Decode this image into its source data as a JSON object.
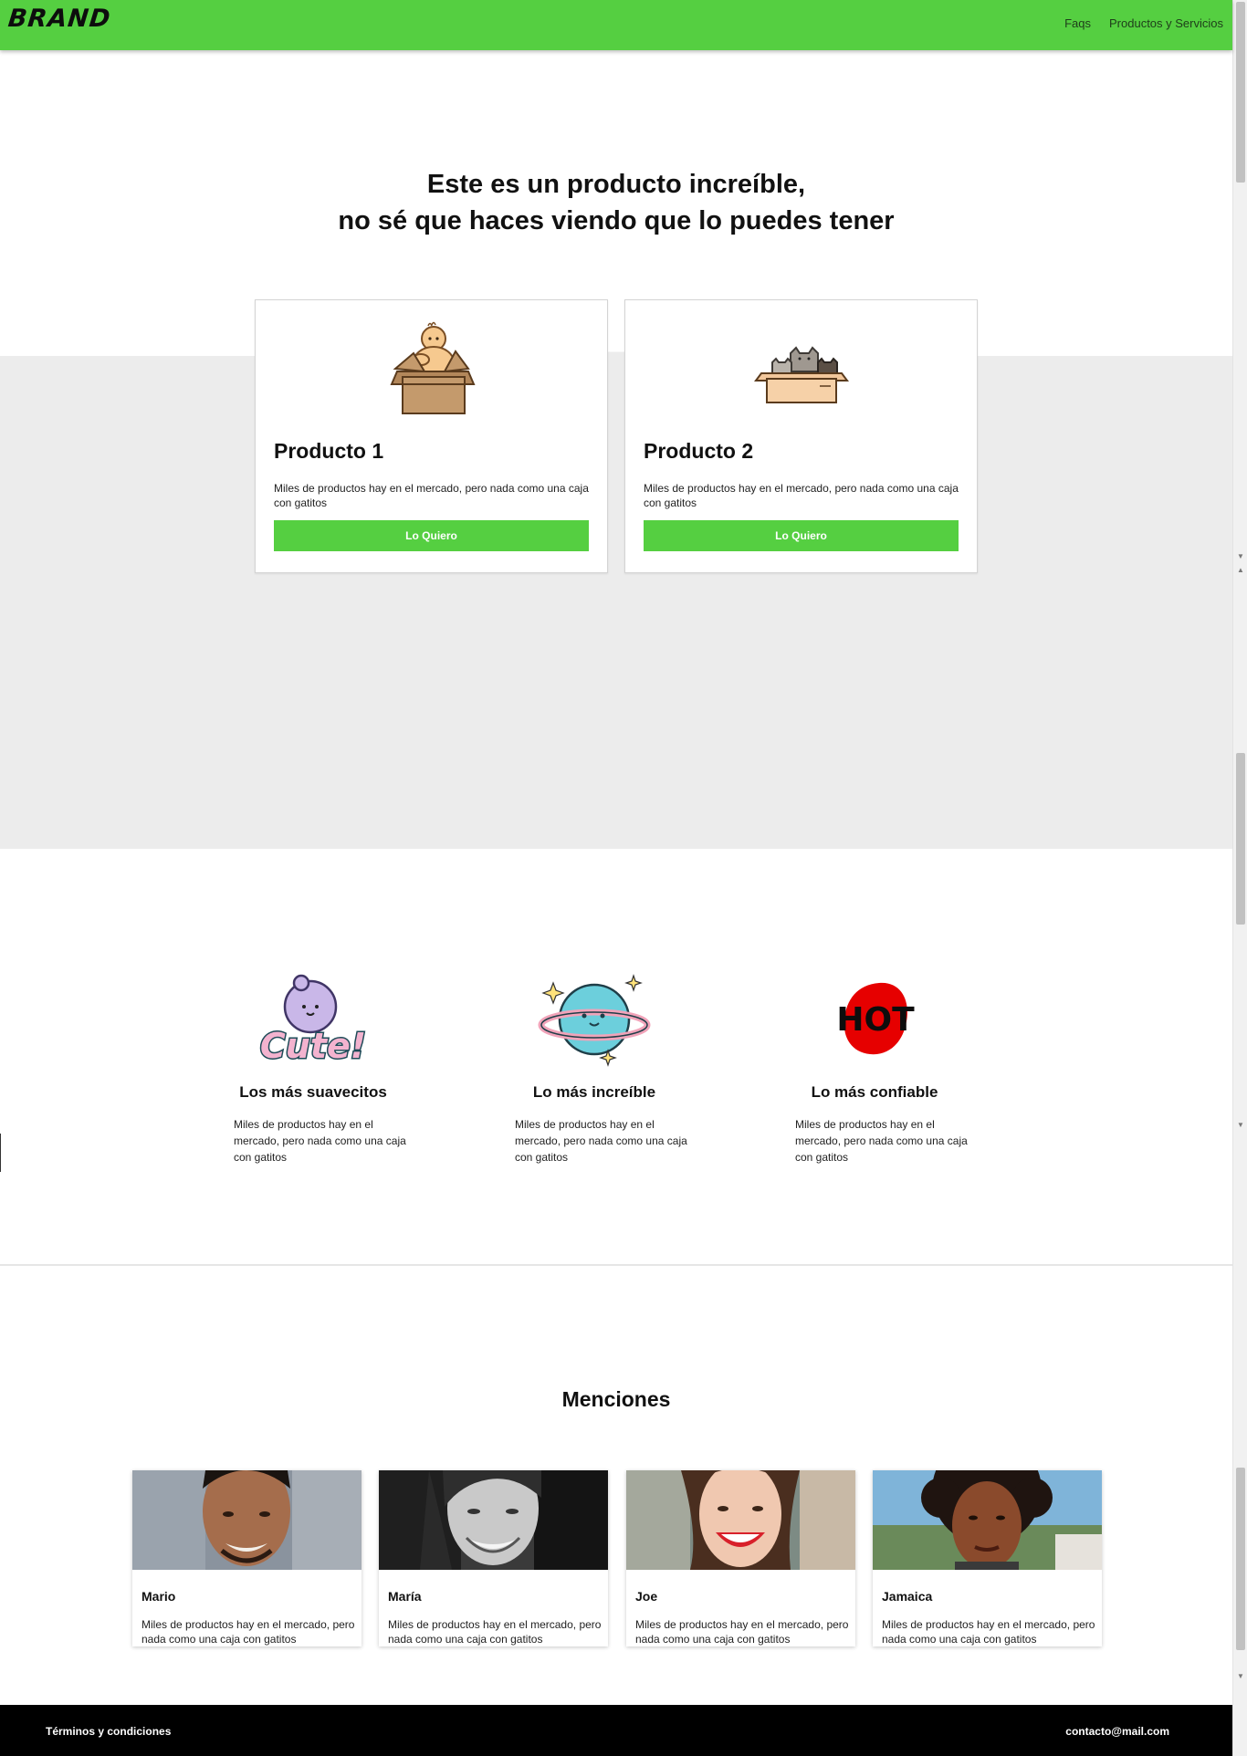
{
  "navbar": {
    "brand": "BRAND",
    "links": [
      "Faqs",
      "Productos y Servicios"
    ],
    "color": "#55cf41"
  },
  "hero": {
    "title_line1": "Este es un producto increíble,",
    "title_line2": "no sé que haces viendo que lo puedes tener"
  },
  "products": [
    {
      "name": "Producto 1",
      "description": "Miles de productos hay en el mercado, pero nada como una caja con gatitos",
      "button": "Lo Quiero",
      "icon": "baby-in-box-icon"
    },
    {
      "name": "Producto 2",
      "description": "Miles de productos hay en el mercado, pero nada como una caja con gatitos",
      "button": "Lo Quiero",
      "icon": "cats-in-box-icon"
    }
  ],
  "features": [
    {
      "title": "Los más suavecitos",
      "description": "Miles de productos hay en el mercado, pero nada como una caja con gatitos",
      "icon": "cute-sticker-icon",
      "sticker_text": "Cute!"
    },
    {
      "title": "Lo más increíble",
      "description": "Miles de productos hay en el mercado, pero nada como una caja con gatitos",
      "icon": "planet-icon"
    },
    {
      "title": "Lo más confiable",
      "description": "Miles de productos hay en el mercado, pero nada como una caja con gatitos",
      "icon": "hot-sticker-icon",
      "sticker_text": "HOT"
    }
  ],
  "mentions": {
    "title": "Menciones",
    "people": [
      {
        "name": "Mario",
        "description": "Miles de productos hay en el mercado, pero nada como una caja con gatitos"
      },
      {
        "name": "María",
        "description": "Miles de productos hay en el mercado, pero nada como una caja con gatitos"
      },
      {
        "name": "Joe",
        "description": "Miles de productos hay en el mercado, pero nada como una caja con gatitos"
      },
      {
        "name": "Jamaica",
        "description": "Miles de productos hay en el mercado, pero nada como una caja con gatitos"
      }
    ]
  },
  "footer": {
    "terms": "Términos y condiciones",
    "email": "contacto@mail.com"
  }
}
